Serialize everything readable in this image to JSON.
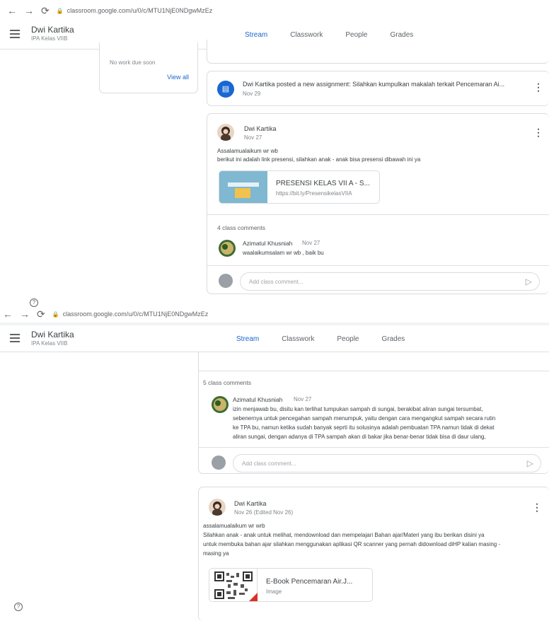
{
  "panel_top": {
    "browser": {
      "url": "classroom.google.com/u/0/c/MTU1NjE0NDgwMzEz"
    },
    "app": {
      "class_name": "Dwi Kartika",
      "section": "IPA Kelas VIIB"
    },
    "tabs": [
      "Stream",
      "Classwork",
      "People",
      "Grades"
    ],
    "upcoming": {
      "no_work": "No work due soon",
      "view_all": "View all"
    },
    "assignment": {
      "text": "Dwi Kartika posted a new assignment: Silahkan kumpulkan makalah terkait Pencemaran Ai...",
      "date": "Nov 29"
    },
    "post": {
      "author": "Dwi Kartika",
      "date": "Nov 27",
      "line1": "Assalamualaikum wr wb",
      "line2": "berikut ini adalah link presensi, silahkan anak - anak bisa presensi dibawah ini ya",
      "attachment_title": "PRESENSI KELAS VII A - S...",
      "attachment_sub": "https://bit.ly/PresensikelasVIIA",
      "comments_count": "4 class comments",
      "comment_author": "Azimatul Khusniah",
      "comment_date": "Nov 27",
      "comment_text": "waalaikumsalam wr wb , baik bu",
      "comment_placeholder": "Add class comment..."
    }
  },
  "panel_bottom": {
    "browser": {
      "url": "classroom.google.com/u/0/c/MTU1NjE0NDgwMzEz"
    },
    "app": {
      "class_name": "Dwi Kartika",
      "section": "IPA Kelas VIIB"
    },
    "tabs": [
      "Stream",
      "Classwork",
      "People",
      "Grades"
    ],
    "comments_count": "5 class comments",
    "comment": {
      "author": "Azimatul Khusniah",
      "date": "Nov 27",
      "lines": [
        "izin menjawab bu, disitu kan terlihat tumpukan sampah di sungai, berakibat aliran sungai tersumbat,",
        "sebenernya untuk pencegahan sampah menumpuk, yaitu dengan cara mengangkut sampah secara rutin",
        "ke TPA bu, namun ketika sudah banyak seprti itu solusinya adalah pembuatan TPA namun tidak di dekat",
        "aliran sungai, dengan adanya di TPA sampah akan di bakar jika benar-benar tidak bisa di daur ulang,"
      ]
    },
    "comment_placeholder": "Add class comment...",
    "post": {
      "author": "Dwi Kartika",
      "date": "Nov 26 (Edited Nov 26)",
      "lines": [
        "assalamualaikum wr wrb",
        "Silahkan anak - anak untuk melihat, mendownload dan mempelajari Bahan ajar/Materi yang ibu berikan disini ya",
        "untuk membuka bahan ajar silahkan menggunakan aplikasi QR scanner yang pernah didownload diHP kalian masing -",
        "masing ya"
      ],
      "attachment_title": "E-Book Pencemaran Air.J...",
      "attachment_sub": "Image"
    }
  },
  "colors": {
    "accent": "#1967d2",
    "divider": "#dadce0"
  }
}
